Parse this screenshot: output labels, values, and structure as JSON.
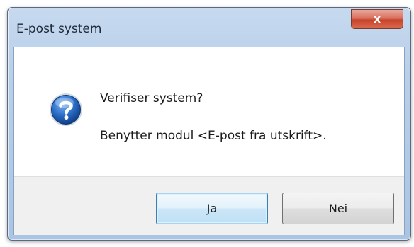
{
  "window": {
    "title": "E-post system",
    "close_label": "x"
  },
  "message": {
    "question": "Verifiser system?",
    "detail": "Benytter modul <E-post fra utskrift>."
  },
  "buttons": {
    "yes_label": "Ja",
    "no_label": "Nei"
  },
  "icons": {
    "dialog_icon": "question-icon",
    "close_icon": "close-icon"
  },
  "colors": {
    "icon_blue": "#1e5fb6",
    "close_red": "#c8442b"
  }
}
